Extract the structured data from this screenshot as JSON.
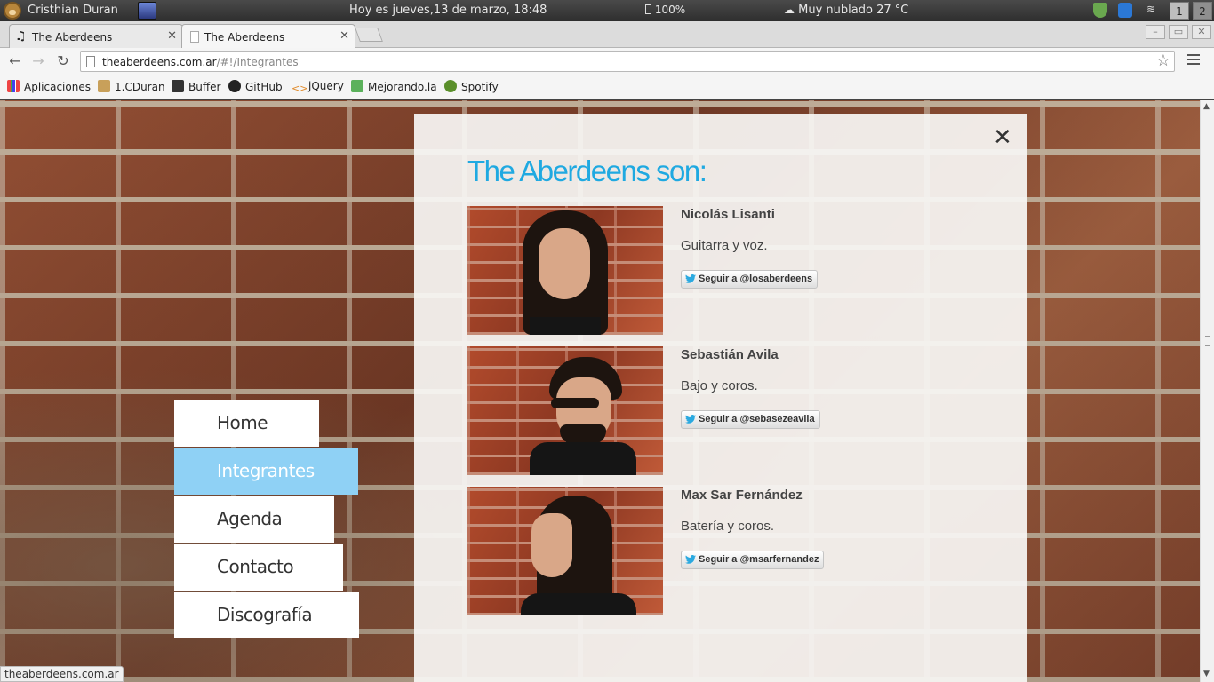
{
  "system_panel": {
    "user_name": "Cristhian Duran",
    "datetime": "Hoy es jueves,13 de marzo, 18:48",
    "battery": "100%",
    "weather": "Muy nublado 27 °C",
    "workspaces": [
      "1",
      "2"
    ]
  },
  "browser": {
    "tabs": [
      {
        "title": "The Aberdeens",
        "icon": "music-note-icon",
        "active": false
      },
      {
        "title": "The Aberdeens",
        "icon": "page-icon",
        "active": true
      }
    ],
    "url_host": "theaberdeens.com.ar",
    "url_path": "/#!/Integrantes",
    "bookmarks": [
      {
        "label": "Aplicaciones",
        "icon": "apps-grid-icon"
      },
      {
        "label": "1.CDuran",
        "icon": "folder-icon"
      },
      {
        "label": "Buffer",
        "icon": "buffer-icon"
      },
      {
        "label": "GitHub",
        "icon": "github-icon"
      },
      {
        "label": "jQuery",
        "icon": "jquery-icon"
      },
      {
        "label": "Mejorando.la",
        "icon": "mejorandola-icon"
      },
      {
        "label": "Spotify",
        "icon": "spotify-icon"
      }
    ],
    "status_url": "theaberdeens.com.ar"
  },
  "nav": {
    "items": [
      {
        "label": "Home",
        "active": false
      },
      {
        "label": "Integrantes",
        "active": true
      },
      {
        "label": "Agenda",
        "active": false
      },
      {
        "label": "Contacto",
        "active": false
      },
      {
        "label": "Discografía",
        "active": false
      }
    ]
  },
  "panel": {
    "title": "The Aberdeens son:",
    "close_symbol": "✕",
    "members": [
      {
        "name": "Nicolás Lisanti",
        "role": "Guitarra y voz.",
        "follow_label": "Seguir a @losaberdeens"
      },
      {
        "name": "Sebastián Avila",
        "role": "Bajo y coros.",
        "follow_label": "Seguir a @sebasezeavila"
      },
      {
        "name": "Max Sar Fernández",
        "role": "Batería y coros.",
        "follow_label": "Seguir a @msarfernandez"
      }
    ]
  },
  "colors": {
    "accent": "#1fa9e1",
    "nav_active": "#8fd1f5"
  }
}
